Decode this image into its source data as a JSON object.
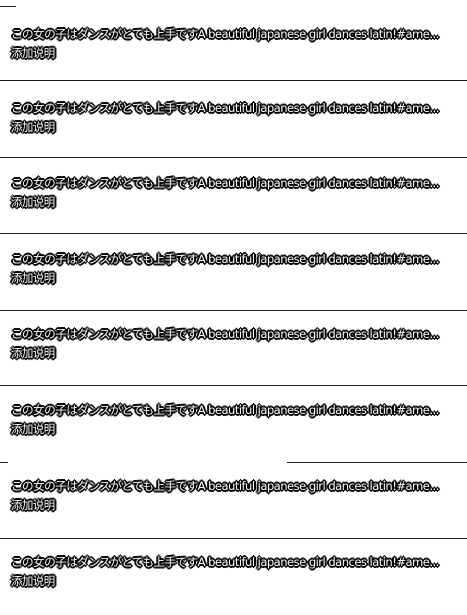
{
  "items": [
    {
      "title": "この女の子はダンスがとても上手ですA beautiful japanese girl dances latin!#ame...",
      "description": "添加说明"
    },
    {
      "title": "この女の子はダンスがとても上手ですA beautiful japanese girl dances latin!#ame...",
      "description": "添加说明"
    },
    {
      "title": "この女の子はダンスがとても上手ですA beautiful japanese girl dances latin!#ame...",
      "description": "添加说明"
    },
    {
      "title": "この女の子はダンスがとても上手ですA beautiful japanese girl dances latin!#ame...",
      "description": "添加说明"
    },
    {
      "title": "この女の子はダンスがとても上手ですA beautiful japanese girl dances latin!#ame...",
      "description": "添加说明"
    },
    {
      "title": "この女の子はダンスがとても上手ですA beautiful japanese girl dances latin!#ame...",
      "description": "添加说明"
    },
    {
      "title": "この女の子はダンスがとても上手ですA beautiful japanese girl dances latin!#ame...",
      "description": "添加说明"
    },
    {
      "title": "この女の子はダンスがとても上手ですA beautiful japanese girl dances latin!#ame...",
      "description": "添加说明"
    }
  ]
}
